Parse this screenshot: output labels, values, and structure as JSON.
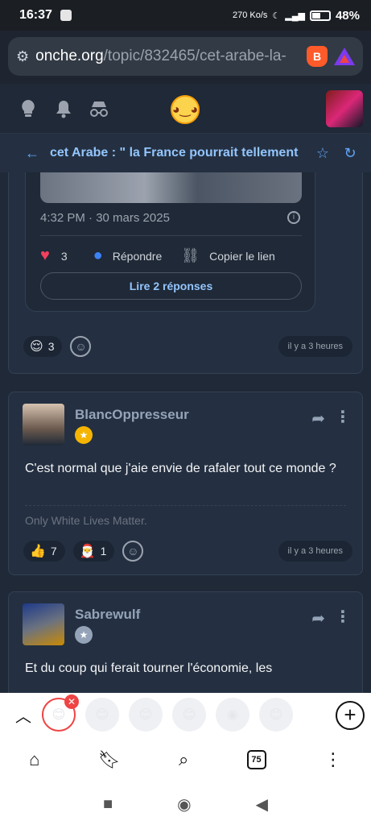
{
  "status": {
    "time": "16:37",
    "net_speed": "270 Ko/s",
    "battery": "48%"
  },
  "browser": {
    "url_host": "onche.org",
    "url_path": "/topic/832465/cet-arabe-la-"
  },
  "topic": {
    "title": "cet Arabe : \" la France pourrait tellement"
  },
  "tweet": {
    "date": "4:32 PM · 30 mars 2025",
    "likes": "3",
    "reply": "Répondre",
    "copy": "Copier le lien",
    "read": "Lire 2 réponses"
  },
  "post0": {
    "react_count": "3",
    "time": "il y a 3 heures"
  },
  "post1": {
    "author": "BlancOppresseur",
    "body": "C'est normal que j'aie envie de rafaler tout ce monde ?",
    "signature": "Only White Lives Matter.",
    "react1_count": "7",
    "react2_count": "1",
    "time": "il y a 3 heures"
  },
  "post2": {
    "author": "Sabrewulf",
    "body": "Et du coup qui ferait tourner l'économie, les"
  },
  "bottom": {
    "tab_count": "75"
  }
}
